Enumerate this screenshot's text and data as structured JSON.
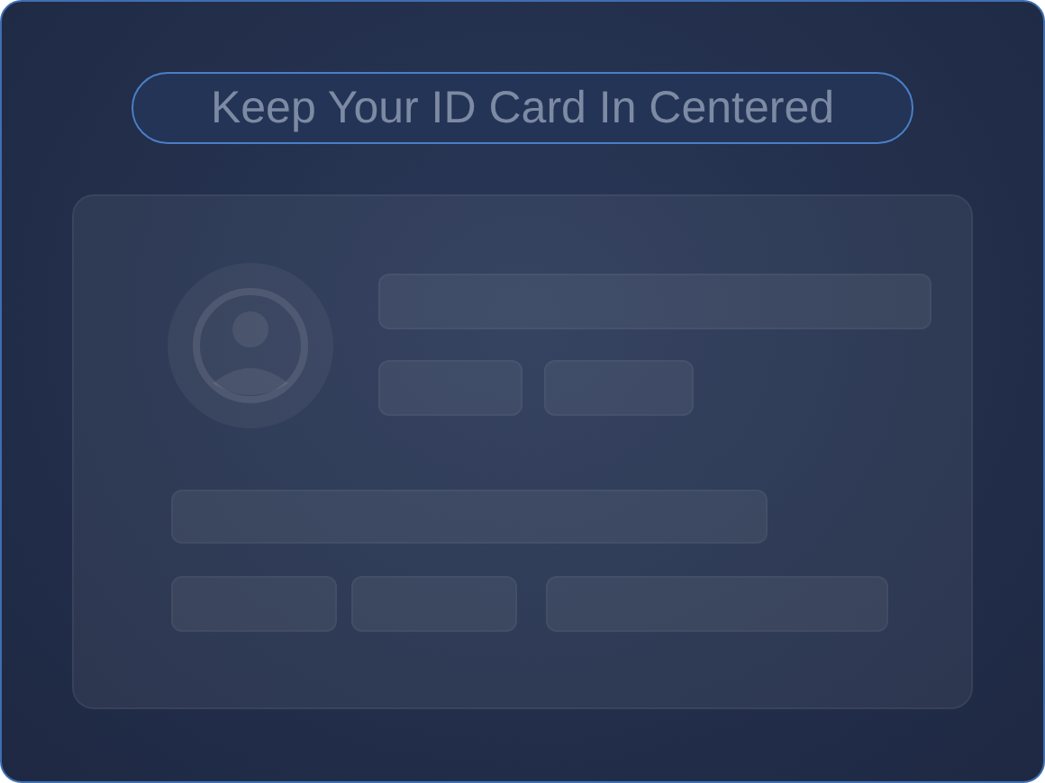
{
  "title": {
    "text": "Keep Your ID Card In Centered"
  }
}
